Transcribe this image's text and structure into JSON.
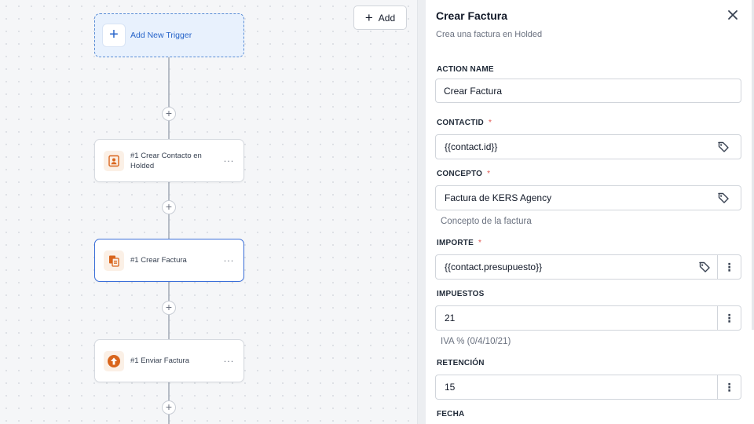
{
  "canvas": {
    "trigger_label": "Add New Trigger",
    "add_button_label": "Add",
    "nodes": [
      {
        "label": "#1 Crear Contacto en Holded",
        "icon": "contact-card-icon"
      },
      {
        "label": "#1 Crear Factura",
        "icon": "invoice-document-icon"
      },
      {
        "label": "#1 Enviar Factura",
        "icon": "upload-arrow-icon"
      }
    ],
    "more_glyph": "···",
    "plus_glyph": "+"
  },
  "panel": {
    "title": "Crear Factura",
    "subtitle": "Crea una factura en Holded",
    "fields": {
      "action_name": {
        "label": "ACTION NAME",
        "value": "Crear Factura"
      },
      "contactid": {
        "label": "CONTACTID",
        "value": "{{contact.id}}",
        "required": "*"
      },
      "concepto": {
        "label": "CONCEPTO",
        "value": "Factura de KERS Agency",
        "required": "*",
        "help": "Concepto de la factura"
      },
      "importe": {
        "label": "IMPORTE",
        "value": "{{contact.presupuesto}}",
        "required": "*"
      },
      "impuestos": {
        "label": "IMPUESTOS",
        "value": "21",
        "help": "IVA % (0/4/10/21)"
      },
      "retencion": {
        "label": "RETENCIÓN",
        "value": "15"
      },
      "fecha": {
        "label": "FECHA"
      }
    }
  },
  "colors": {
    "accent_blue": "#2563c9",
    "selected_border": "#3b6fd9",
    "required_red": "#e0554f",
    "icon_orange": "#d9651c"
  }
}
